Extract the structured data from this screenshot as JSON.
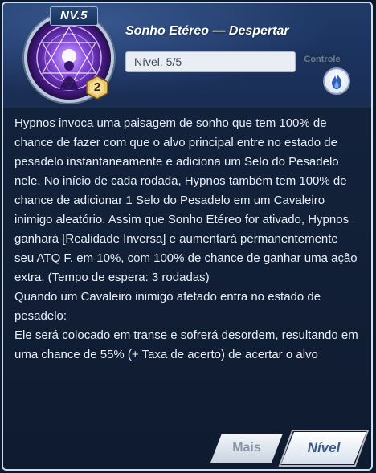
{
  "skill": {
    "level_tag": "NV.5",
    "badge_count": "2",
    "title": "Sonho Etéreo — Despertar",
    "level_text": "Nível. 5/5",
    "side_label": "Controle"
  },
  "icons": {
    "skill_icon": "hypnos-skill-icon",
    "element_icon": "flame-element-icon",
    "badge_icon": "hexagon-rank-badge"
  },
  "description": "Hypnos invoca uma paisagem de sonho que tem 100% de chance de fazer com que o alvo principal entre no estado de pesadelo instantaneamente e adiciona um Selo do Pesadelo nele. No início de cada rodada, Hypnos também tem 100% de chance de adicionar 1 Selo do Pesadelo em um Cavaleiro inimigo aleatório. Assim que Sonho Etéreo for ativado, Hypnos ganhará [Realidade Inversa] e aumentará permanentemente seu ATQ F. em 10%, com 100% de chance de ganhar uma ação extra. (Tempo de espera: 3 rodadas)\nQuando um Cavaleiro inimigo afetado entra no estado de pesadelo:\nEle será colocado em transe e sofrerá desordem, resultando em uma chance de 55% (+ Taxa de acerto) de acertar o alvo",
  "buttons": {
    "more": "Mais",
    "level": "Nível"
  },
  "colors": {
    "panel_bg": "#122038",
    "header_bg": "#1c3360",
    "text": "#e8eef6",
    "button_text_active": "#3b5a86",
    "button_text_inactive": "#8a96a8"
  }
}
